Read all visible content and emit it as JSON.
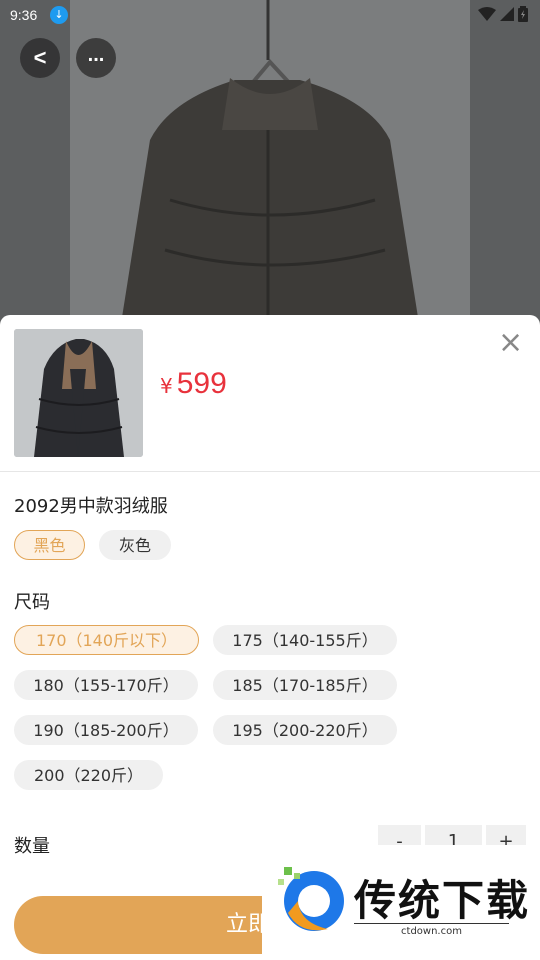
{
  "status_bar": {
    "time": "9:36"
  },
  "nav": {
    "back_glyph": "<",
    "more_glyph": "..."
  },
  "product": {
    "currency": "¥",
    "price": "599",
    "name": "2092男中款羽绒服"
  },
  "colors": {
    "options": [
      "黑色",
      "灰色"
    ],
    "selected": "黑色"
  },
  "size": {
    "title": "尺码",
    "options": [
      "170（140斤以下）",
      "175（140-155斤）",
      "180（155-170斤）",
      "185（170-185斤）",
      "190（185-200斤）",
      "195（200-220斤）",
      "200（220斤）"
    ],
    "selected": "170（140斤以下）"
  },
  "quantity": {
    "label": "数量",
    "value": "1",
    "minus": "-",
    "plus": "+"
  },
  "buy_button": {
    "label": "立即购买"
  },
  "watermark": {
    "title": "传统下载",
    "url": "ctdown.com"
  },
  "theme": {
    "accent": "#e2a557",
    "price_red": "#e8323c",
    "chip_bg": "#f0f0f0"
  }
}
